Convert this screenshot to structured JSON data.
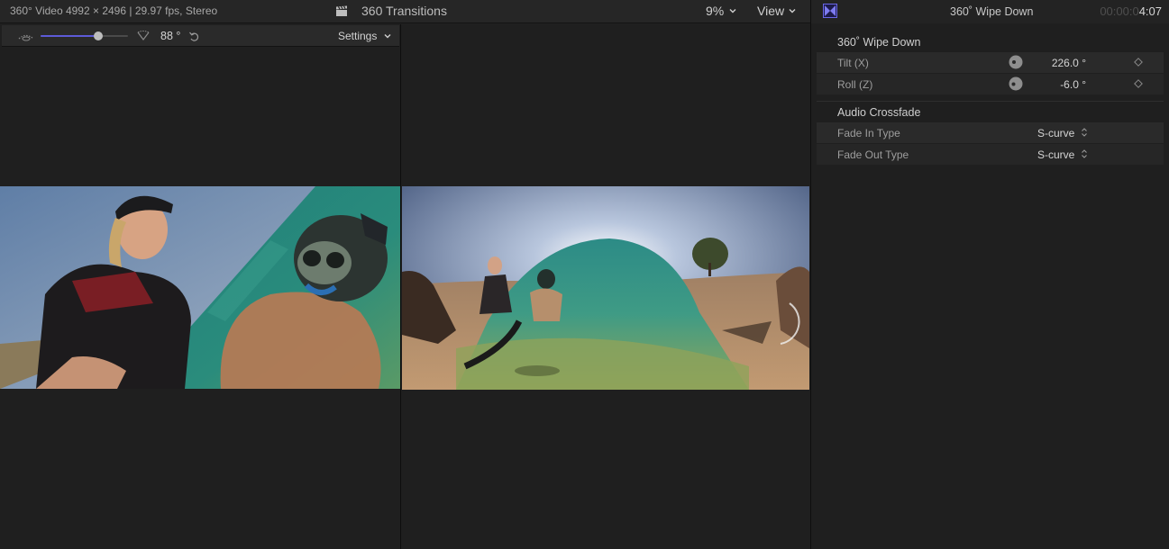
{
  "viewer": {
    "format_info": "360° Video 4992 × 2496 | 29.97 fps, Stereo",
    "title": "360 Transitions",
    "zoom": "9%",
    "view_label": "View",
    "toolbar": {
      "fov_degrees": "88 °",
      "fov_slider_fraction": 0.66,
      "settings_label": "Settings"
    }
  },
  "inspector": {
    "title": "360˚ Wipe Down",
    "timecode_dim": "00:00:0",
    "timecode_bright": "4:07",
    "sections": [
      {
        "title": "360˚ Wipe Down",
        "rows": [
          {
            "label": "Tilt (X)",
            "value": "226.0 °"
          },
          {
            "label": "Roll (Z)",
            "value": "-6.0 °"
          }
        ]
      },
      {
        "title": "Audio Crossfade",
        "rows": [
          {
            "label": "Fade In Type",
            "value": "S-curve"
          },
          {
            "label": "Fade Out Type",
            "value": "S-curve"
          }
        ]
      }
    ]
  },
  "colors": {
    "accent": "#5d5bd8",
    "background": "#1e1e1e",
    "panel": "#262626"
  },
  "icons": [
    "clapperboard-icon",
    "chevron-down-icon",
    "fov-narrow-icon",
    "fov-wide-icon",
    "reset-icon",
    "transition-icon",
    "dial-icon",
    "keyframe-diamond-icon",
    "up-down-arrows-icon"
  ]
}
